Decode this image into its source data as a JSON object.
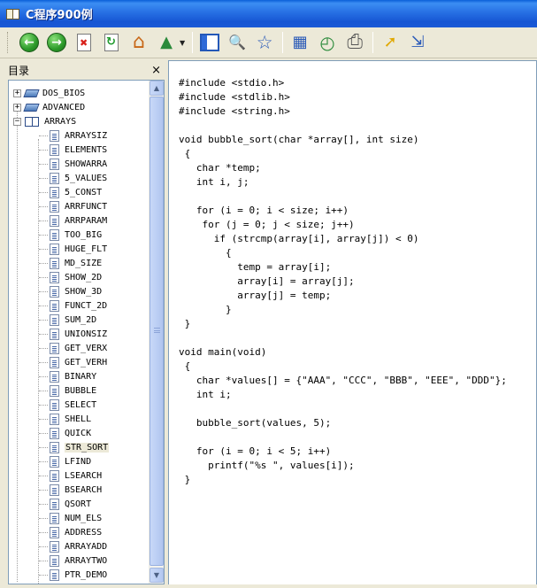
{
  "window": {
    "title": "C程序900例"
  },
  "toolbar": {
    "buttons": [
      {
        "name": "back-button",
        "icon": "arrow-left-icon",
        "glyph": "←"
      },
      {
        "name": "forward-button",
        "icon": "arrow-right-icon",
        "glyph": "→"
      },
      {
        "name": "stop-button",
        "icon": "stop-doc-icon"
      },
      {
        "name": "refresh-button",
        "icon": "refresh-doc-icon"
      },
      {
        "name": "home-button",
        "icon": "home-icon",
        "glyph": "⌂"
      },
      {
        "name": "sync-button",
        "icon": "sync-tree-icon",
        "glyph": "▲"
      },
      {
        "name": "show-pane-button",
        "icon": "pane-icon"
      },
      {
        "name": "search-button",
        "icon": "magnifier-icon",
        "glyph": "🔍"
      },
      {
        "name": "favorites-button",
        "icon": "star-icon",
        "glyph": "☆"
      },
      {
        "name": "export-button",
        "icon": "chart-icon",
        "glyph": "▦"
      },
      {
        "name": "history-button",
        "icon": "clock-icon",
        "glyph": "◴"
      },
      {
        "name": "print-button",
        "icon": "printer-icon",
        "glyph": "⎙"
      },
      {
        "name": "pointer-button",
        "icon": "pointer-icon",
        "glyph": "➚"
      },
      {
        "name": "exit-button",
        "icon": "exit-icon",
        "glyph": "⇲"
      }
    ]
  },
  "sidebar": {
    "title": "目录",
    "close_label": "×",
    "top_items": [
      {
        "label": "DOS_BIOS",
        "expander": "+"
      },
      {
        "label": "ADVANCED",
        "expander": "+"
      },
      {
        "label": "ARRAYS",
        "expander": "−"
      }
    ],
    "children": [
      "ARRAYSIZ",
      "ELEMENTS",
      "SHOWARRA",
      "5_VALUES",
      "5_CONST",
      "ARRFUNCT",
      "ARRPARAM",
      "TOO_BIG",
      "HUGE_FLT",
      "MD_SIZE",
      "SHOW_2D",
      "SHOW_3D",
      "FUNCT_2D",
      "SUM_2D",
      "UNIONSIZ",
      "GET_VERX",
      "GET_VERH",
      "BINARY",
      "BUBBLE",
      "SELECT",
      "SHELL",
      "QUICK",
      "STR_SORT",
      "LFIND",
      "LSEARCH",
      "BSEARCH",
      "QSORT",
      "NUM_ELS",
      "ADDRESS",
      "ARRAYADD",
      "ARRAYTWO",
      "PTR_DEMO"
    ],
    "selected": "STR_SORT",
    "scroll_up": "▲",
    "scroll_down": "▼"
  },
  "code": {
    "lines": [
      "#include <stdio.h>",
      "#include <stdlib.h>",
      "#include <string.h>",
      "",
      "void bubble_sort(char *array[], int size)",
      " {",
      "   char *temp;",
      "   int i, j;",
      "",
      "   for (i = 0; i < size; i++)",
      "    for (j = 0; j < size; j++)",
      "      if (strcmp(array[i], array[j]) < 0)",
      "        {",
      "          temp = array[i];",
      "          array[i] = array[j];",
      "          array[j] = temp;",
      "        }",
      " }",
      "",
      "void main(void)",
      " {",
      "   char *values[] = {\"AAA\", \"CCC\", \"BBB\", \"EEE\", \"DDD\"};",
      "   int i;",
      "",
      "   bubble_sort(values, 5);",
      "",
      "   for (i = 0; i < 5; i++)",
      "     printf(\"%s \", values[i]);",
      " }"
    ]
  }
}
